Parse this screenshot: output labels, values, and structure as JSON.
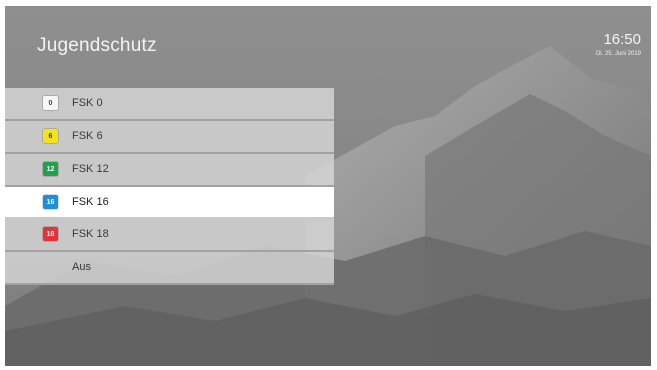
{
  "header": {
    "title": "Jugendschutz",
    "time": "16:50",
    "date": "Di. 25. Juni 2019"
  },
  "menu": {
    "selected_index": 3,
    "items": [
      {
        "label": "FSK 0",
        "badge": "0",
        "badge_color": "#f7f7f7",
        "badge_text_color": "#444444"
      },
      {
        "label": "FSK 6",
        "badge": "6",
        "badge_color": "#f5e21a",
        "badge_text_color": "#3b3b00"
      },
      {
        "label": "FSK 12",
        "badge": "12",
        "badge_color": "#1fa24a",
        "badge_text_color": "#ffffff"
      },
      {
        "label": "FSK 16",
        "badge": "16",
        "badge_color": "#1d8fe0",
        "badge_text_color": "#ffffff"
      },
      {
        "label": "FSK 18",
        "badge": "18",
        "badge_color": "#e53238",
        "badge_text_color": "#ffffff"
      },
      {
        "label": "Aus"
      }
    ]
  }
}
